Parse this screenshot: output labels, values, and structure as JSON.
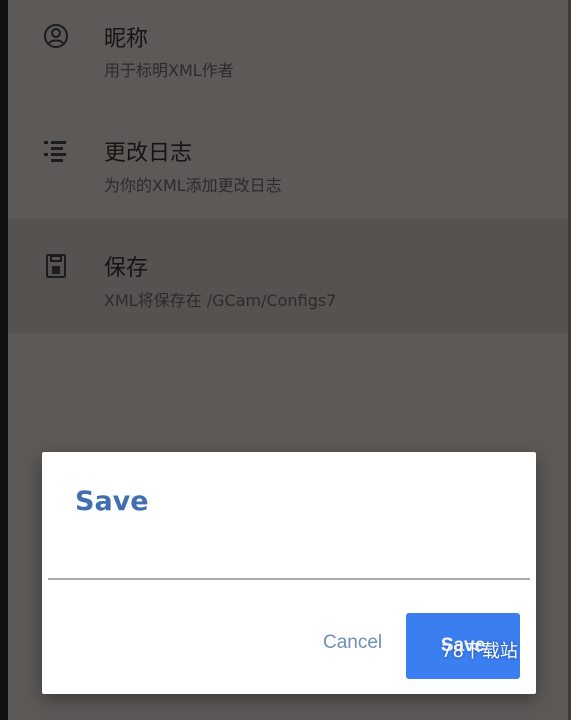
{
  "settings": {
    "items": [
      {
        "icon": "account-circle-icon",
        "title": "昵称",
        "summary": "用于标明XML作者"
      },
      {
        "icon": "notes-list-icon",
        "title": "更改日志",
        "summary": "为你的XML添加更改日志"
      },
      {
        "icon": "save-floppy-icon",
        "title": "保存",
        "summary": "XML将保存在 /GCam/Configs7"
      }
    ]
  },
  "dialog": {
    "title": "Save",
    "input_value": "",
    "cancel_label": "Cancel",
    "save_label": "Save"
  },
  "watermark": {
    "text": "78下载站"
  },
  "colors": {
    "scrim": "#5c5957",
    "accent": "#3a7ef0",
    "dialog_title": "#3f6fb0"
  }
}
